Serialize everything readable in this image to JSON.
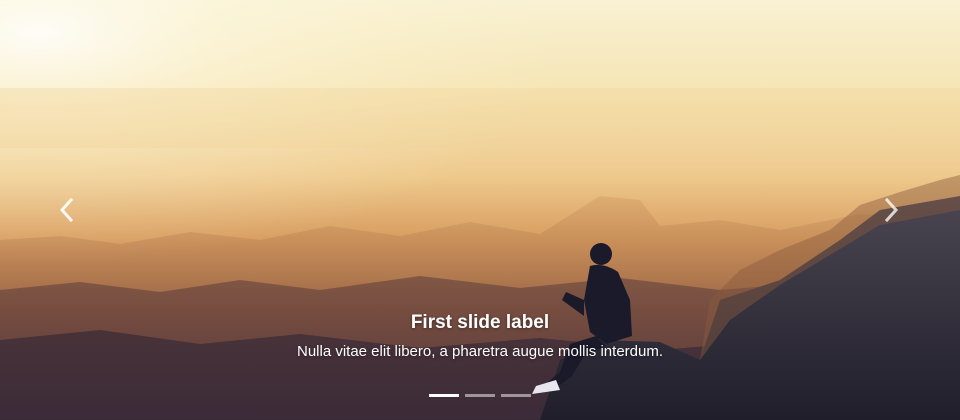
{
  "carousel": {
    "slides": [
      {
        "label": "First slide label",
        "text": "Nulla vitae elit libero, a pharetra augue mollis interdum.",
        "active": true
      },
      {
        "active": false
      },
      {
        "active": false
      }
    ],
    "controls": {
      "prev_icon": "chevron-left-icon",
      "next_icon": "chevron-right-icon"
    },
    "colors": {
      "sky_top": "#fbf3cf",
      "haze": "#e9c083",
      "ground": "#7a4a2e",
      "rock": "#3a3a4a",
      "indicator": "#ffffff"
    }
  }
}
